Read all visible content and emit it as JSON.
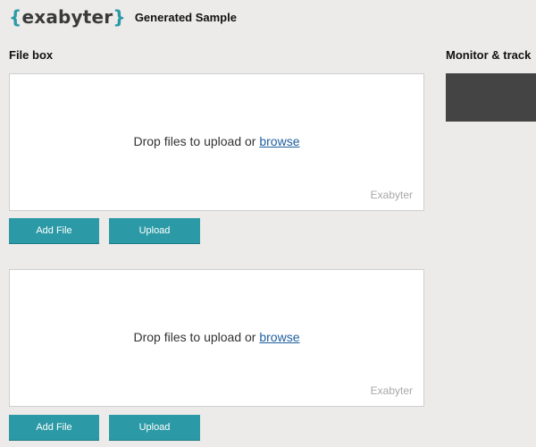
{
  "header": {
    "logo_open": "{",
    "logo_word": "exabyter",
    "logo_close": "}",
    "title": "Generated Sample"
  },
  "sections": {
    "file_box": "File box",
    "monitor": "Monitor & track"
  },
  "uploaders": [
    {
      "drop_text": "Drop files to upload or ",
      "browse_link": "browse",
      "watermark": "Exabyter",
      "add_file_label": "Add File",
      "upload_label": "Upload"
    },
    {
      "drop_text": "Drop files to upload or ",
      "browse_link": "browse",
      "watermark": "Exabyter",
      "add_file_label": "Add File",
      "upload_label": "Upload"
    }
  ],
  "colors": {
    "accent": "#2b9aa6",
    "background": "#ecebea",
    "monitor_panel": "#444444",
    "link": "#1f5fa0"
  }
}
